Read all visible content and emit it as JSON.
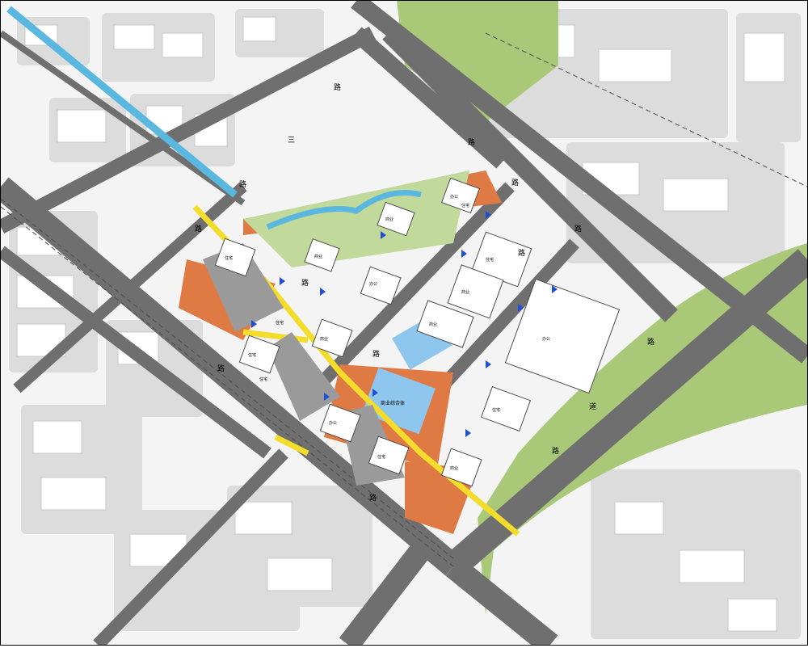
{
  "map": {
    "colors": {
      "background": "#f4f4f4",
      "block": "#d9d9d9",
      "road": "#6f6f6f",
      "road_dark": "#555555",
      "greenery": "#a9c978",
      "river": "#59b7e0",
      "plaza": "#e07a45",
      "walkway": "#f3dd2a",
      "glass": "#8ec6ee",
      "tower_shadow": "#9a9a9a"
    },
    "road_labels": [
      "路",
      "三",
      "路",
      "路",
      "路",
      "路",
      "路",
      "路",
      "路",
      "路",
      "路",
      "路",
      "道",
      "路",
      "路"
    ],
    "building_labels": [
      "住宅",
      "商业",
      "办公",
      "商业",
      "办公",
      "住宅",
      "商业",
      "办公",
      "住宅",
      "商业",
      "住宅",
      "商业",
      "商业",
      "办公",
      "住宅",
      "住宅",
      "住宅",
      "住宅"
    ],
    "center_label": "商业综合体"
  }
}
